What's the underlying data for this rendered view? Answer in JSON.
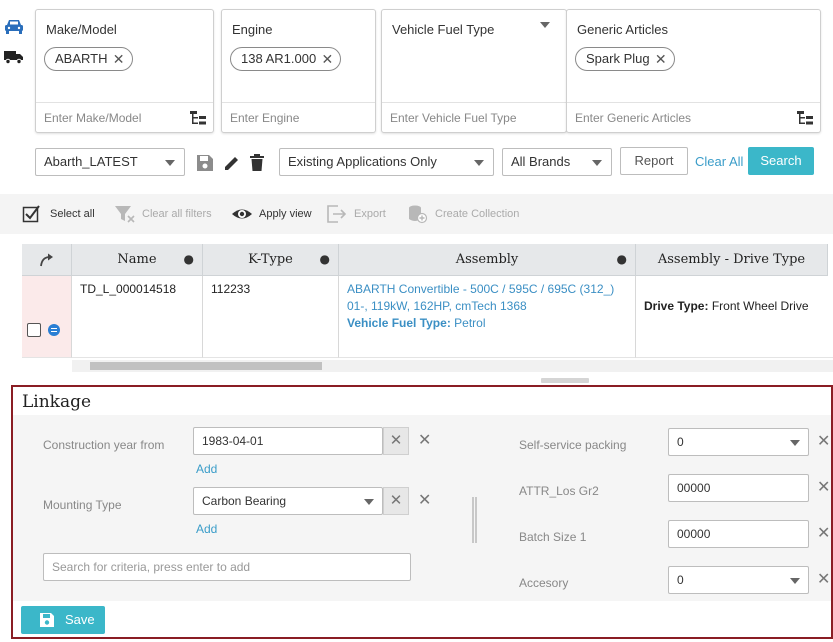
{
  "filters": {
    "make_model": {
      "title": "Make/Model",
      "chip": "ABARTH",
      "placeholder": "Enter Make/Model"
    },
    "engine": {
      "title": "Engine",
      "chip": "138 AR1.000",
      "placeholder": "Enter Engine"
    },
    "fuel_type": {
      "title": "Vehicle Fuel Type",
      "placeholder": "Enter Vehicle Fuel Type"
    },
    "generic_articles": {
      "title": "Generic Articles",
      "chip": "Spark Plug",
      "placeholder": "Enter Generic Articles"
    }
  },
  "toolbar": {
    "dataset": "Abarth_LATEST",
    "applications": "Existing Applications Only",
    "brands": "All Brands",
    "report": "Report",
    "clear_all": "Clear All",
    "search": "Search"
  },
  "actions": {
    "select_all": "Select all",
    "clear_filters": "Clear all filters",
    "apply_view": "Apply view",
    "export": "Export",
    "create_collection": "Create Collection"
  },
  "grid": {
    "columns": [
      "Name",
      "K-Type",
      "Assembly",
      "Assembly - Drive Type"
    ],
    "row": {
      "name": "TD_L_000014518",
      "ktype": "112233",
      "assembly_link": "ABARTH Convertible - 500C / 595C / 695C (312_) 01-, 119kW, 162HP, cmTech 1368",
      "fuel_label": "Vehicle Fuel Type:",
      "fuel_value": "Petrol",
      "drive_label": "Drive Type:",
      "drive_value": "Front Wheel Drive"
    }
  },
  "linkage": {
    "title": "Linkage",
    "construction_year_label": "Construction year from",
    "construction_year_value": "1983-04-01",
    "add_label": "Add",
    "mounting_type_label": "Mounting Type",
    "mounting_type_value": "Carbon Bearing",
    "search_placeholder": "Search for criteria, press enter to add",
    "self_service_label": "Self-service packing",
    "self_service_value": "0",
    "attr_los_label": "ATTR_Los Gr2",
    "attr_los_value": "00000",
    "batch_size_label": "Batch Size 1",
    "batch_size_value": "00000",
    "accesory_label": "Accesory",
    "accesory_value": "0",
    "save_label": "Save"
  },
  "colors": {
    "primary": "#3bb7c9",
    "link": "#3b9dc9",
    "panel_border": "#8a1d24",
    "rail_blue": "#2a6ebb"
  }
}
